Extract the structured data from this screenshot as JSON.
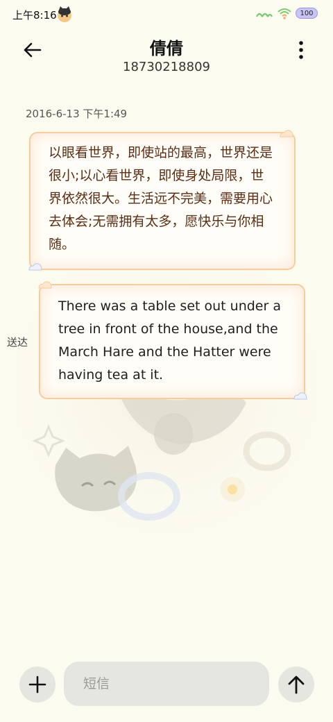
{
  "status_bar": {
    "time": "上午8:16",
    "signal_label": "ᯤ",
    "battery": "100"
  },
  "header": {
    "contact_name": "倩倩",
    "contact_number": "18730218809"
  },
  "conversation": {
    "timestamp": "2016-6-13 下午1:49",
    "messages": [
      {
        "direction": "received",
        "text": "以眼看世界，即使站的最高，世界还是很小;以心看世界，即使身处局限，世界依然很大。生活远不完美，需要用心去体会;无需拥有太多，愿快乐与你相随。"
      },
      {
        "direction": "sent",
        "text": "There was a table set out under a tree in front of the house,and the March Hare and the Hatter were having tea at it.",
        "status": "送达"
      }
    ]
  },
  "composer": {
    "placeholder": "短信"
  },
  "colors": {
    "background": "#fcfbf0",
    "bubble_border": "#f6cc9a",
    "button_bg": "#e6e6e0"
  },
  "icons": [
    "back-arrow-icon",
    "more-vertical-icon",
    "plus-icon",
    "send-arrow-icon",
    "wifi-icon",
    "pet-avatar-icon"
  ]
}
